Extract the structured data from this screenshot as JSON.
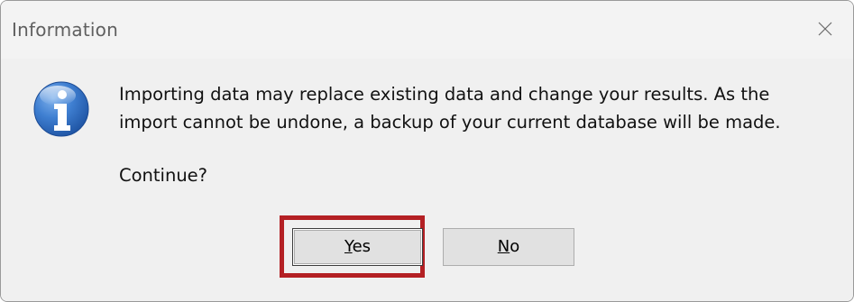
{
  "window": {
    "title": "Information",
    "close_icon": "close-icon"
  },
  "message": {
    "line1": "Importing data may replace existing data and change your results. As the",
    "line2": "import cannot be undone, a backup of your current database will be made.",
    "question": "Continue?",
    "icon": "information-icon"
  },
  "buttons": {
    "yes": {
      "mnemonic": "Y",
      "rest": "es"
    },
    "no": {
      "mnemonic": "N",
      "rest": "o"
    }
  },
  "colors": {
    "highlight": "#b42024",
    "dialog_background": "#f0f0f0",
    "icon_blue": "#2b63b3"
  }
}
